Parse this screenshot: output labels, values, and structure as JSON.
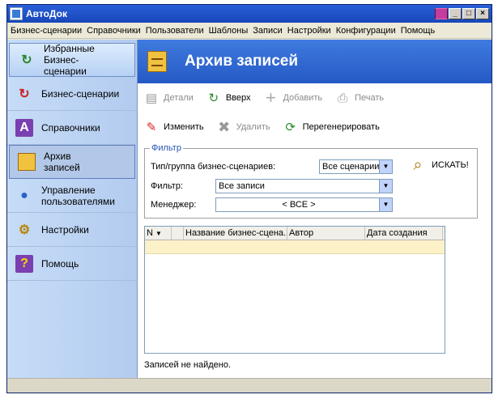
{
  "window": {
    "title": "АвтоДок"
  },
  "menu": [
    "Бизнес-сценарии",
    "Справочники",
    "Пользователи",
    "Шаблоны",
    "Записи",
    "Настройки",
    "Конфигурации",
    "Помощь"
  ],
  "sidebar": {
    "items": [
      {
        "label": "Избранные Бизнес-сценарии",
        "icon": "favorites-icon"
      },
      {
        "label": "Бизнес-сценарии",
        "icon": "cycle-icon"
      },
      {
        "label": "Справочники",
        "icon": "book-icon"
      },
      {
        "label": "Архив записей",
        "icon": "cabinet-icon"
      },
      {
        "label": "Управление пользователями",
        "icon": "users-icon"
      },
      {
        "label": "Настройки",
        "icon": "gears-icon"
      },
      {
        "label": "Помощь",
        "icon": "help-icon"
      }
    ]
  },
  "header": {
    "title": "Архив записей"
  },
  "toolbar": {
    "details": "Детали",
    "up": "Вверх",
    "add": "Добавить",
    "print": "Печать",
    "edit": "Изменить",
    "delete": "Удалить",
    "regenerate": "Перегенерировать"
  },
  "filter": {
    "legend": "Фильтр",
    "type_label": "Тип/группа бизнес-сценариев:",
    "type_value": "Все сценарии",
    "filter_label": "Фильтр:",
    "filter_value": "Все записи",
    "manager_label": "Менеджер:",
    "manager_value": "< ВСЕ >",
    "search_label": "ИСКАТЬ!"
  },
  "grid": {
    "columns": [
      "N",
      "Название бизнес-сцена...",
      "Автор",
      "Дата создания"
    ]
  },
  "status": {
    "message": "Записей не найдено."
  },
  "colors": {
    "accent": "#2559c4",
    "sidebar": "#c6dcf7",
    "row_highlight": "#fdf1c8"
  }
}
